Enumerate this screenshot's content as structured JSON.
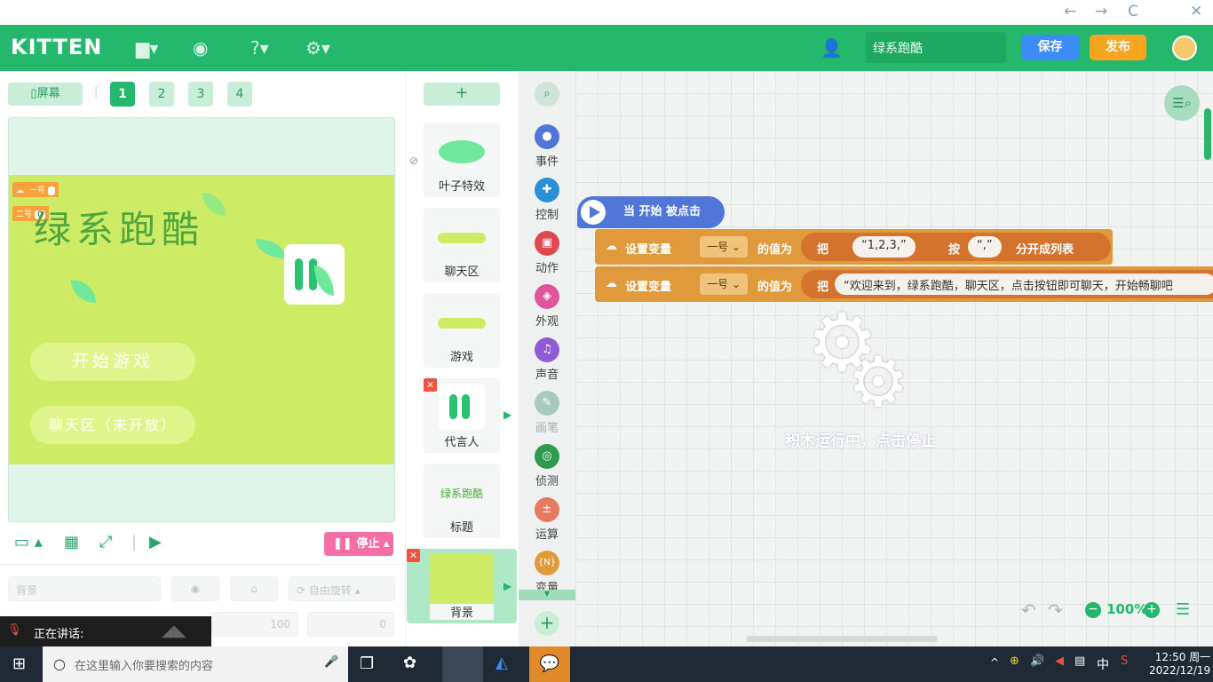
{
  "window": {
    "nav": [
      "←",
      "→",
      "C",
      "✕"
    ]
  },
  "header": {
    "logo": "KITTEN",
    "project_name": "绿系跑酷",
    "save_label": "保存",
    "publish_label": "发布",
    "brand_color": "#23b86c"
  },
  "stage_panel": {
    "screen_label": "屏幕",
    "pages": [
      "1",
      "2",
      "3",
      "4"
    ],
    "game_title": "绿系跑酷",
    "start_button": "开始游戏",
    "chat_button": "聊天区（未开放）",
    "var_one": {
      "label": "一号",
      "value": ""
    },
    "var_two": {
      "label": "二号",
      "value": "0"
    },
    "stop_label": "停止",
    "props": {
      "name_placeholder": "背景",
      "rotate_label": "自由旋转",
      "size_value": "100",
      "direction_value": "0"
    }
  },
  "sprites": {
    "add_label": "+",
    "items": [
      {
        "label": "叶子特效"
      },
      {
        "label": "聊天区"
      },
      {
        "label": "游戏"
      },
      {
        "label": "代言人"
      },
      {
        "label": "标题",
        "thumb_text": "绿系跑酷"
      },
      {
        "label": "背景"
      }
    ]
  },
  "categories": [
    {
      "label": "事件",
      "color": "#4f76d8"
    },
    {
      "label": "控制",
      "color": "#2b8fd6"
    },
    {
      "label": "动作",
      "color": "#e1474e"
    },
    {
      "label": "外观",
      "color": "#e0559a"
    },
    {
      "label": "声音",
      "color": "#8f5ad4"
    },
    {
      "label": "画笔",
      "color": "#a8c9bd"
    },
    {
      "label": "侦测",
      "color": "#2e9b4e"
    },
    {
      "label": "运算",
      "color": "#e57a5e"
    },
    {
      "label": "变量",
      "color": "#e09a3c"
    }
  ],
  "workspace": {
    "hat_label": "当 开始 被点击",
    "block1": {
      "set": "设置变量",
      "var": "一号",
      "value_of": "的值为",
      "ba": "把",
      "string": "“1,2,3,”",
      "by": "按",
      "sep": "“,”",
      "split": "分开成列表"
    },
    "block2": {
      "set": "设置变量",
      "var": "一号",
      "value_of": "的值为",
      "ba": "把",
      "string": "“欢迎来到，绿系跑酷，聊天区，点击按钮即可聊天，开始畅聊吧"
    },
    "running_msg": "积木运行中，点击停止",
    "zoom": "100%"
  },
  "voice": {
    "label": "正在讲话:"
  },
  "taskbar": {
    "search_placeholder": "在这里输入你要搜索的内容",
    "ime": "中",
    "time": "12:50 周一",
    "date": "2022/12/19"
  }
}
